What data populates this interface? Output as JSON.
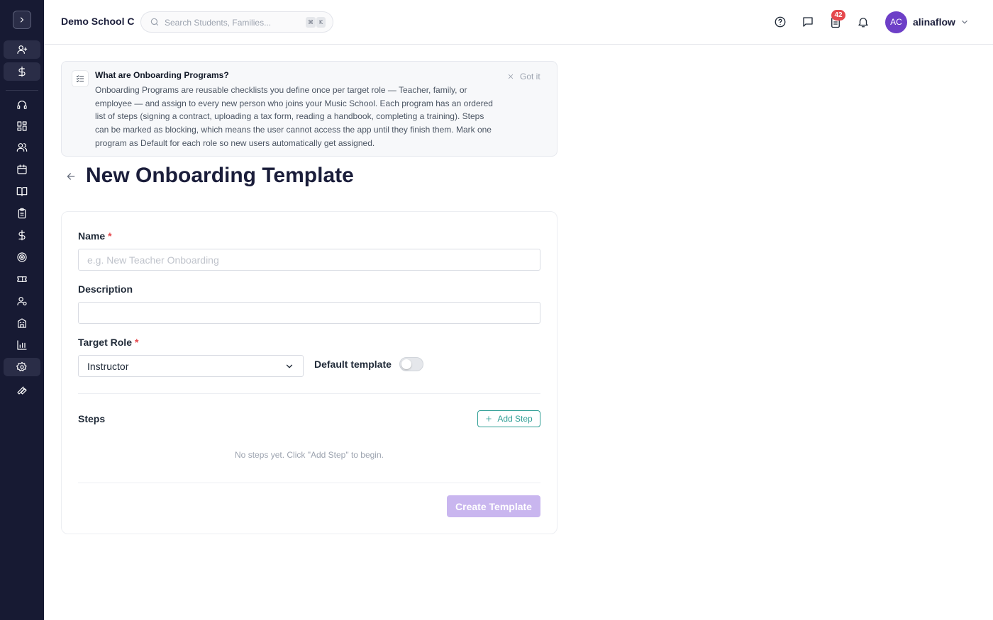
{
  "header": {
    "school_name": "Demo School C",
    "search_placeholder": "Search Students, Families...",
    "search_shortcut": [
      "⌘",
      "K"
    ],
    "tasks_badge": "42",
    "user": {
      "initials": "AC",
      "name": "alinaflow",
      "avatar_color": "#6d3fc7"
    }
  },
  "sidebar": {
    "items": [
      {
        "icon": "user-plus-icon"
      },
      {
        "icon": "dollar-icon"
      },
      {
        "icon": "headset-icon"
      },
      {
        "icon": "dashboard-icon"
      },
      {
        "icon": "users-icon"
      },
      {
        "icon": "calendar-icon"
      },
      {
        "icon": "book-open-icon"
      },
      {
        "icon": "clipboard-icon"
      },
      {
        "icon": "dollar-icon"
      },
      {
        "icon": "target-icon"
      },
      {
        "icon": "ticket-icon"
      },
      {
        "icon": "user-settings-icon"
      },
      {
        "icon": "building-icon"
      },
      {
        "icon": "bar-chart-icon"
      },
      {
        "icon": "gear-icon"
      },
      {
        "icon": "wrench-icon"
      }
    ]
  },
  "banner": {
    "title": "What are Onboarding Programs?",
    "body": "Onboarding Programs are reusable checklists you define once per target role — Teacher, family, or employee — and assign to every new person who joins your Music School. Each program has an ordered list of steps (signing a contract, uploading a tax form, reading a handbook, completing a training). Steps can be marked as blocking, which means the user cannot access the app until they finish them. Mark one program as Default for each role so new users automatically get assigned.",
    "dismiss_label": "Got it"
  },
  "page": {
    "title": "New Onboarding Template"
  },
  "form": {
    "name_label": "Name",
    "required_mark": "*",
    "name_placeholder": "e.g. New Teacher Onboarding",
    "name_value": "",
    "description_label": "Description",
    "description_value": "",
    "target_role_label": "Target Role",
    "target_role_value": "Instructor",
    "default_template_label": "Default template",
    "default_template_on": false,
    "steps_label": "Steps",
    "add_step_label": "Add Step",
    "empty_steps_text": "No steps yet. Click \"Add Step\" to begin.",
    "submit_label": "Create Template"
  },
  "colors": {
    "sidebar_bg": "#171a33",
    "accent_teal": "#2f9e95",
    "submit_disabled": "#c9b6ef",
    "badge_red": "#e5484d"
  }
}
